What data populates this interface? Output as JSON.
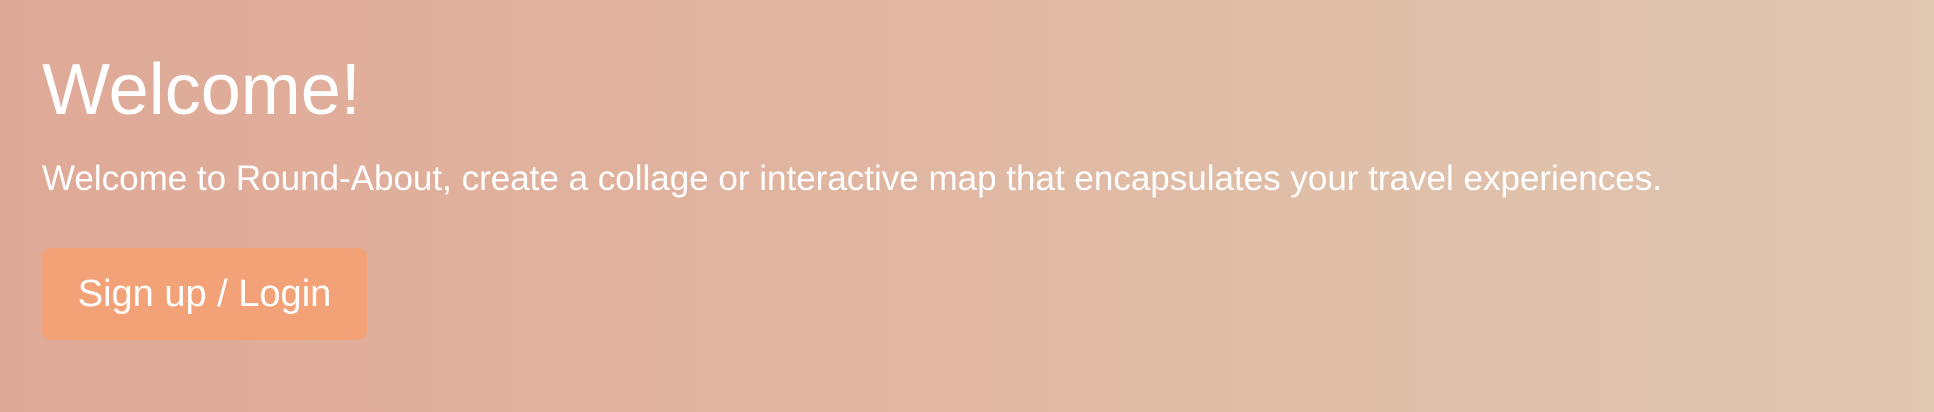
{
  "hero": {
    "title": "Welcome!",
    "description": "Welcome to Round-About, create a collage or interactive map that encapsulates your travel experiences.",
    "button_label": "Sign up / Login"
  },
  "colors": {
    "gradient_start": "#dfa997",
    "gradient_end": "#e0c7b2",
    "button": "#f2a276",
    "text": "#ffffff"
  }
}
